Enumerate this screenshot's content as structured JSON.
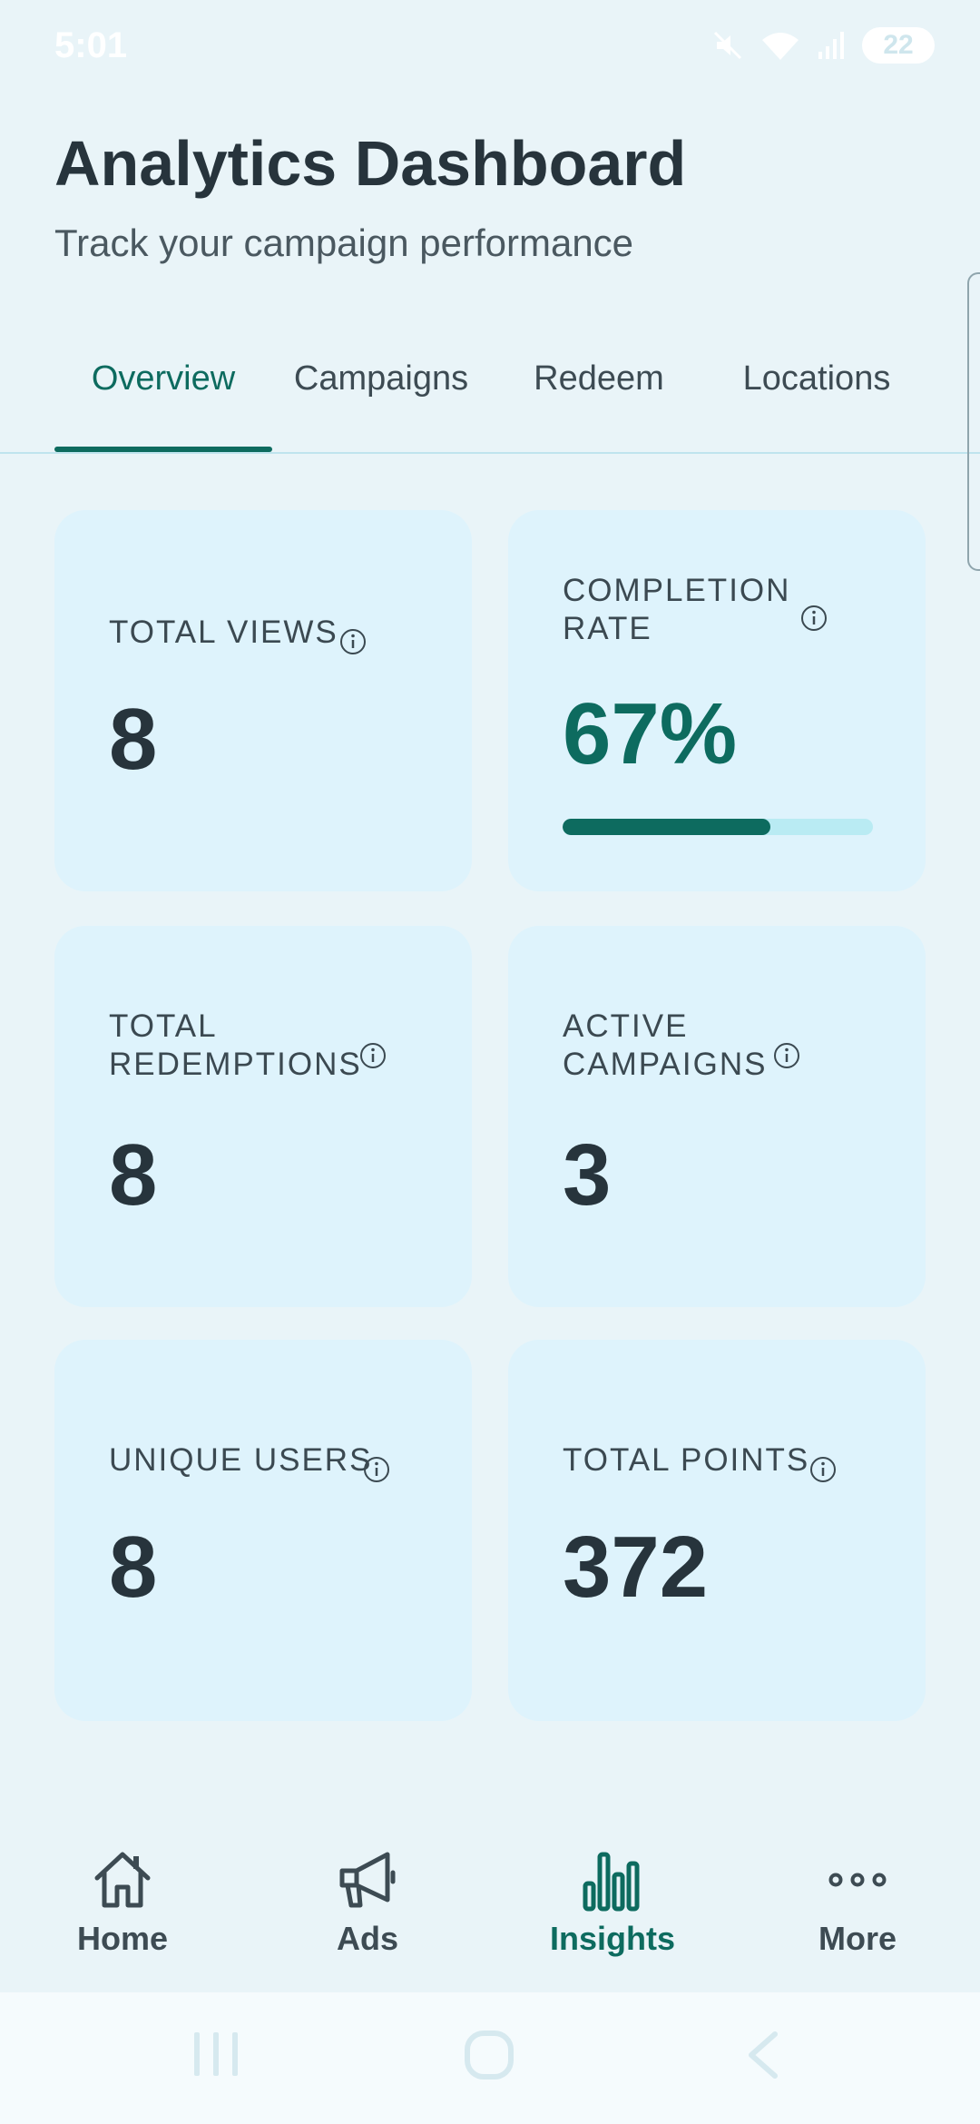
{
  "status_bar": {
    "time": "5:01",
    "battery": "22"
  },
  "header": {
    "title": "Analytics Dashboard",
    "subtitle": "Track your campaign performance"
  },
  "tabs": [
    {
      "label": "Overview",
      "active": true
    },
    {
      "label": "Campaigns",
      "active": false
    },
    {
      "label": "Redeem",
      "active": false
    },
    {
      "label": "Locations",
      "active": false
    }
  ],
  "metrics": {
    "total_views": {
      "label": "TOTAL VIEWS",
      "value": "8"
    },
    "completion_rate": {
      "label_line1": "COMPLETION",
      "label_line2": "RATE",
      "value": "67%",
      "progress": 0.67
    },
    "total_redemptions": {
      "label_line1": "TOTAL",
      "label_line2": "REDEMPTIONS",
      "value": "8"
    },
    "active_campaigns": {
      "label_line1": "ACTIVE",
      "label_line2": "CAMPAIGNS",
      "value": "3"
    },
    "unique_users": {
      "label": "UNIQUE USERS",
      "value": "8"
    },
    "total_points": {
      "label": "TOTAL POINTS",
      "value": "372"
    }
  },
  "bottom_nav": [
    {
      "label": "Home",
      "icon": "home-icon",
      "active": false
    },
    {
      "label": "Ads",
      "icon": "megaphone-icon",
      "active": false
    },
    {
      "label": "Insights",
      "icon": "bar-chart-icon",
      "active": true
    },
    {
      "label": "More",
      "icon": "more-dots-icon",
      "active": false
    }
  ],
  "colors": {
    "accent": "#0d6b5f",
    "background": "#e9f4f8",
    "card": "#def3fc",
    "progress_track": "#b9ebf3"
  }
}
